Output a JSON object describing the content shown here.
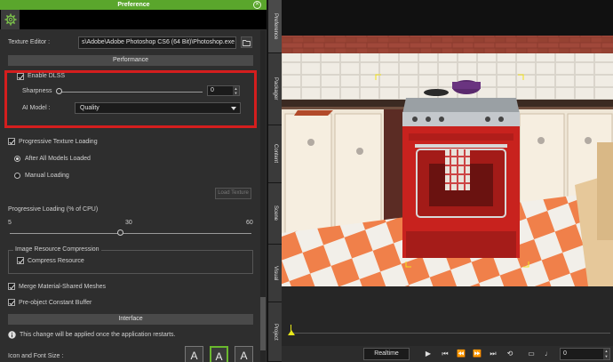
{
  "window": {
    "title": "Preference"
  },
  "texture_editor": {
    "label": "Texture Editor :",
    "path": "s\\Adobe\\Adobe Photoshop CS6 (64 Bit)\\Photoshop.exe"
  },
  "sections": {
    "performance": "Performance",
    "interface": "Interface"
  },
  "dlss": {
    "enable_label": "Enable DLSS",
    "enabled": true,
    "sharpness_label": "Sharpness",
    "sharpness_value": "0",
    "sharpness_level": 0,
    "ai_model_label": "AI Model :",
    "ai_model_value": "Quality"
  },
  "texture_loading": {
    "progressive_label": "Progressive Texture Loading",
    "progressive_checked": true,
    "after_all_label": "After All Models Loaded",
    "manual_label": "Manual Loading",
    "load_button": "Load Texture",
    "progress_title": "Progressive Loading (% of CPU)",
    "tick_min": "5",
    "tick_mid": "30",
    "tick_max": "60",
    "cpu_value": 30
  },
  "image_compression": {
    "group_title": "Image Resource Compression",
    "compress_label": "Compress Resource",
    "compress_checked": true
  },
  "options": {
    "merge_label": "Merge Material-Shared Meshes",
    "merge_checked": true,
    "buffer_label": "Pre-object Constant Buffer",
    "buffer_checked": true
  },
  "interface": {
    "restart_note": "This change will be applied once the application restarts.",
    "font_size_label": "Icon and Font Size :",
    "font_glyph": "A"
  },
  "vertical_tabs": [
    "Preference",
    "Packager",
    "Content",
    "Scene",
    "Visual",
    "Project"
  ],
  "transport": {
    "realtime_label": "Realtime",
    "frame_value": "0"
  },
  "colors": {
    "accent": "#5aa62c",
    "highlight": "#d41e1e",
    "timeline_marker": "#e8e81a"
  }
}
